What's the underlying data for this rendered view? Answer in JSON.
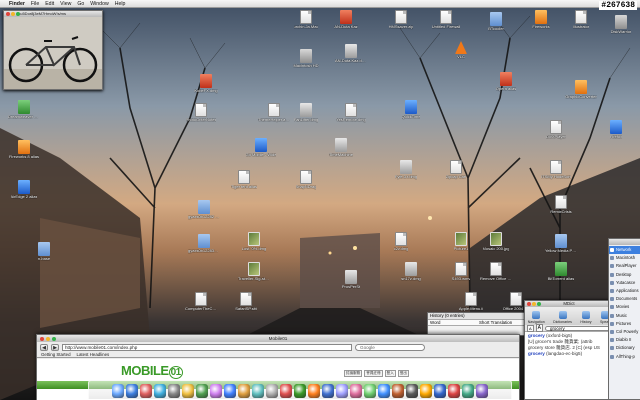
{
  "menubar": {
    "apple": "",
    "app": "Finder",
    "items": [
      "File",
      "Edit",
      "View",
      "Go",
      "Window",
      "Help"
    ]
  },
  "watermark": "#267638",
  "photo_window": {
    "title": "1u5Dor8j3eM7HmoW!s/ms"
  },
  "desktop_icons": [
    {
      "label": "urchin.Ja.Mac",
      "kind": "doc"
    },
    {
      "label": "AN-Duta Kaz",
      "kind": "red"
    },
    {
      "label": "HMSsaver.zip",
      "kind": "doc"
    },
    {
      "label": "Untitled Firewall",
      "kind": "doc"
    },
    {
      "label": "BTcooler",
      "kind": "fold"
    },
    {
      "label": "Fireworks",
      "kind": "org"
    },
    {
      "label": "Illustrator",
      "kind": "doc"
    },
    {
      "label": "DiskWarrior",
      "kind": "drive"
    },
    {
      "label": "Macintosh HD",
      "kind": "drive"
    },
    {
      "label": "AN-Duta.Kaz.dmg",
      "kind": "dmg"
    },
    {
      "label": "Dreamweaver 8 alias",
      "kind": "grn"
    },
    {
      "label": "Fireworks 8 alias",
      "kind": "org"
    },
    {
      "label": "AirEdge 2 alias",
      "kind": "blu"
    },
    {
      "label": "n-base",
      "kind": "fold"
    },
    {
      "label": "KobeFX.dmg",
      "kind": "red"
    },
    {
      "label": "PhotoGriterNotes",
      "kind": "doc"
    },
    {
      "label": "ThemeHelper.aurug",
      "kind": "doc"
    },
    {
      "label": "FanLifter.dmg",
      "kind": "dmg"
    },
    {
      "label": "YesRemote.dmg",
      "kind": "doc"
    },
    {
      "label": "Go Mobile - Wide",
      "kind": "blu"
    },
    {
      "label": "TimeMachine",
      "kind": "dmg"
    },
    {
      "label": "Tiger tent.alias",
      "kind": "doc"
    },
    {
      "label": "SnapNDrag",
      "kind": "doc"
    },
    {
      "label": "Fyfe.3.t.dmg",
      "kind": "dmg"
    },
    {
      "label": "Zipcap Cart",
      "kind": "doc"
    },
    {
      "label": "ITSMy HodeSort",
      "kind": "doc"
    },
    {
      "label": "Firefox",
      "kind": "blu"
    },
    {
      "label": "gyaxs0b12282 Folder",
      "kind": "fold"
    },
    {
      "label": "gyaxs0b122833 Folder",
      "kind": "fold"
    },
    {
      "label": "Lost, 0%.dmg",
      "kind": "img"
    },
    {
      "label": "Traveller-Slg-stops.dmg",
      "kind": "img"
    },
    {
      "label": "ComputerTheCommand",
      "kind": "doc"
    },
    {
      "label": "SafariSP.sitt",
      "kind": "doc"
    },
    {
      "label": "ProsPerSt",
      "kind": "dmg"
    },
    {
      "label": "c2v.dmg",
      "kind": "doc"
    },
    {
      "label": "Picture1",
      "kind": "img"
    },
    {
      "label": "sn17z.dmg",
      "kind": "dmg"
    },
    {
      "label": "S493.wmv",
      "kind": "doc"
    },
    {
      "label": "Remove Office log.txt",
      "kind": "doc"
    },
    {
      "label": "Mosaic 200.jpg",
      "kind": "img"
    },
    {
      "label": "Yellow Media Previews",
      "kind": "fold"
    },
    {
      "label": "BitTorrent alias",
      "kind": "grn"
    },
    {
      "label": "Apple.Menu.ii",
      "kind": "doc"
    },
    {
      "label": "Office 2004 Up",
      "kind": "doc"
    },
    {
      "label": "RemixCrisis",
      "kind": "doc"
    },
    {
      "label": "DivXPlayer",
      "kind": "doc"
    },
    {
      "label": "QuickTime",
      "kind": "blu"
    },
    {
      "label": "VLC",
      "kind": "cone"
    },
    {
      "label": "Opera alias",
      "kind": "red"
    },
    {
      "label": "GraphicConverter",
      "kind": "org"
    }
  ],
  "history": {
    "title": "History (0 entries)",
    "columns": [
      "Word",
      "Short Translation"
    ]
  },
  "dictionary": {
    "title": "MDict",
    "tools": [
      "Navigation",
      "Dictionaries",
      "History",
      "Speak"
    ],
    "size_small": "A",
    "size_large": "A",
    "search_value": "grocery",
    "entries": [
      {
        "headword": "grocery",
        "source": " (oxford-big5)"
      },
      {
        "text": "[U] grocer's trade 雜貨業; (attrib"
      },
      {
        "text": "grocery store 雜貨店. 2 [C] (esp US"
      },
      {
        "headword": "grocery",
        "source": " (langdao-ec-big5)"
      }
    ]
  },
  "sidebar": {
    "items": [
      "Network",
      "Macintosh",
      "RealPlayer",
      "Desktop",
      "Yutacasce",
      "Applications",
      "Documents",
      "Movies",
      "Music",
      "Pictures",
      "Col Powerly",
      "Diablo II",
      "Dictionary",
      "AllThing-p"
    ],
    "selected": 0
  },
  "browser": {
    "title": "Mobile01",
    "back": "◀",
    "forward": "▶",
    "url": "http://www.mobile01.com/index.php",
    "search_placeholder": "Google",
    "bookmarks": [
      "Getting Started",
      "Latest Headlines"
    ],
    "logo_text": "MOBILE",
    "logo_num": "01",
    "mini_links": [
      "討論服務",
      "會員註冊",
      "登入",
      "登出"
    ]
  },
  "colors": {
    "accent": "#3d80df",
    "logo_green": "#3a9a28",
    "close_red": "#e0443a",
    "min_yellow": "#f3b72a",
    "max_green": "#33b24a"
  }
}
